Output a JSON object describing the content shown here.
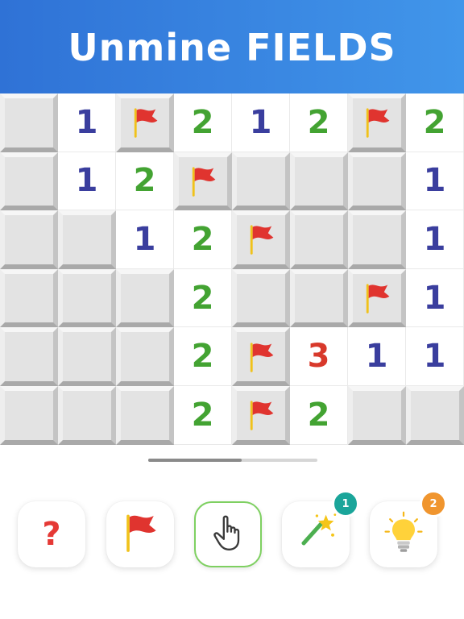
{
  "header": {
    "title": "Unmine FIELDS",
    "background": "#3a85e4"
  },
  "board": {
    "rows": [
      [
        "c",
        "1",
        "f",
        "2",
        "1",
        "2",
        "f",
        "2"
      ],
      [
        "c",
        "1",
        "2",
        "f",
        "c",
        "c",
        "c",
        "1"
      ],
      [
        "c",
        "c",
        "1",
        "2",
        "f",
        "c",
        "c",
        "1"
      ],
      [
        "c",
        "c",
        "c",
        "2",
        "c",
        "c",
        "f",
        "1"
      ],
      [
        "c",
        "c",
        "c",
        "2",
        "f",
        "3",
        "1",
        "1"
      ],
      [
        "c",
        "c",
        "c",
        "2",
        "f",
        "2",
        "c",
        "c"
      ]
    ],
    "legend": {
      "c": "closed-cell",
      "f": "flagged-cell",
      "digit": "revealed-number"
    },
    "number_colors": {
      "1": "#3a3e9e",
      "2": "#43a332",
      "3": "#d8392b"
    }
  },
  "scroll": {
    "progress": 0.55
  },
  "toolbar": {
    "tools": [
      {
        "name": "hint-help",
        "icon": "question-mark-icon",
        "label": "?",
        "active": false
      },
      {
        "name": "flag-mode",
        "icon": "flag-icon",
        "active": false
      },
      {
        "name": "tap-mode",
        "icon": "pointer-hand-icon",
        "active": true
      },
      {
        "name": "magic-wand",
        "icon": "magic-wand-icon",
        "badge": "1",
        "badge_color": "#1aa59a",
        "active": false
      },
      {
        "name": "lightbulb-hint",
        "icon": "lightbulb-icon",
        "badge": "2",
        "badge_color": "#f0952e",
        "active": false
      }
    ]
  }
}
